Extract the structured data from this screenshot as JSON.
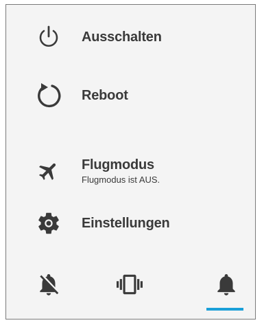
{
  "menu": {
    "power": {
      "label": "Ausschalten",
      "icon": "power-icon"
    },
    "reboot": {
      "label": "Reboot",
      "icon": "reboot-icon"
    },
    "airplane": {
      "label": "Flugmodus",
      "status": "Flugmodus ist AUS.",
      "icon": "airplane-icon"
    },
    "settings": {
      "label": "Einstellungen",
      "icon": "gear-icon"
    }
  },
  "sound_modes": {
    "items": [
      {
        "name": "silent",
        "icon": "bell-off-icon"
      },
      {
        "name": "vibrate",
        "icon": "vibrate-icon"
      },
      {
        "name": "sound",
        "icon": "bell-icon"
      }
    ],
    "selected": "sound",
    "accent_color": "#1a9fd8"
  },
  "colors": {
    "text": "#3a3a3a",
    "icon": "#3a3a3a",
    "background": "#f4f4f4",
    "border": "#7a7a7a"
  }
}
